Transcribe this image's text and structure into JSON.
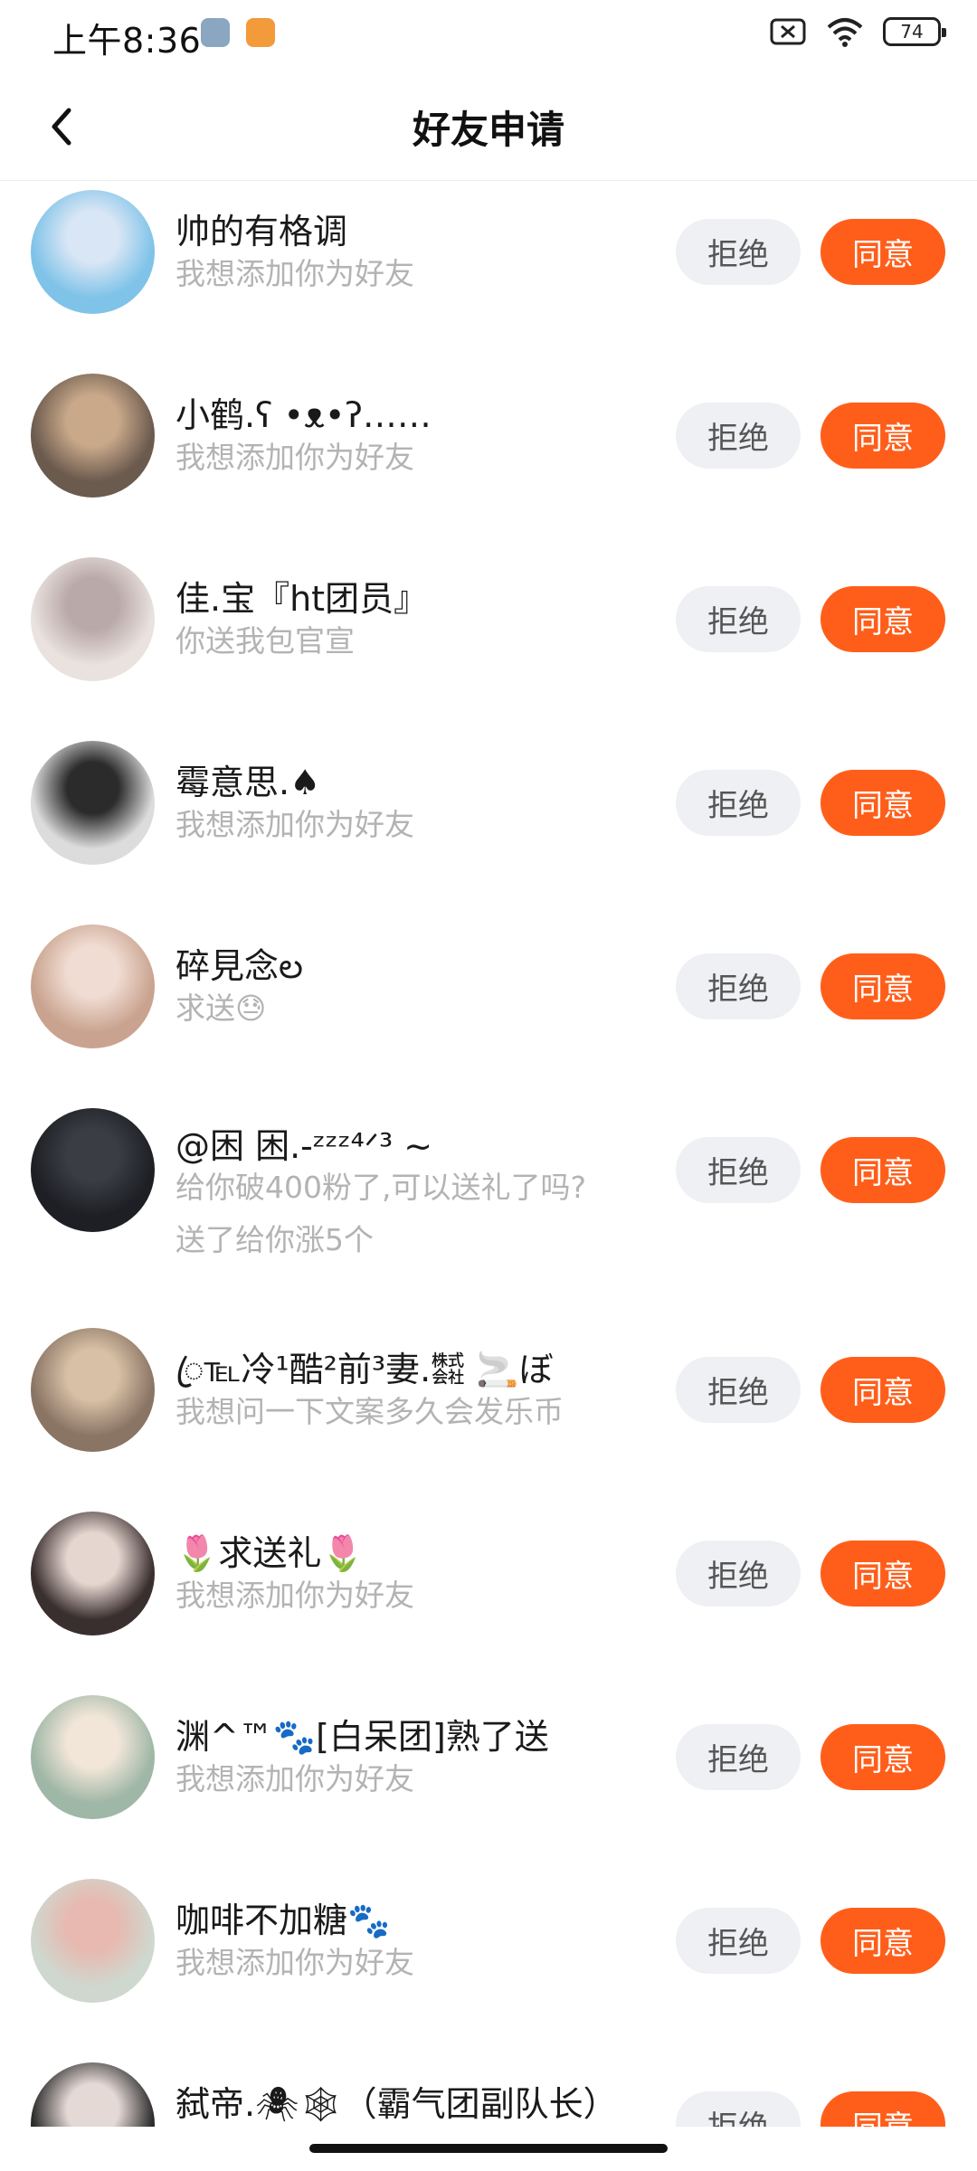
{
  "status_bar": {
    "time": "上午8:36",
    "battery": "74",
    "icons": [
      "auto-rotate-icon",
      "app-notification-icon",
      "no-sim-icon",
      "wifi-icon",
      "battery-icon"
    ]
  },
  "header": {
    "title": "好友申请",
    "back_icon": "chevron-left-icon"
  },
  "buttons": {
    "reject_label": "拒绝",
    "accept_label": "同意"
  },
  "requests": [
    {
      "name": "帅的有格调",
      "message": "我想添加你为好友",
      "avatar_colors": [
        "#7fc3e8",
        "#d9e6f5"
      ]
    },
    {
      "name": "小鹤.ʕ •ᴥ•ʔ……",
      "message": "我想添加你为好友",
      "avatar_colors": [
        "#6b5a4e",
        "#c9a98a"
      ]
    },
    {
      "name": "佳.宝『ht团员』",
      "message": "你送我包官宣",
      "avatar_colors": [
        "#e9e2df",
        "#b9a9a8"
      ]
    },
    {
      "name": "霉意思.♠",
      "message": "我想添加你为好友",
      "avatar_colors": [
        "#dcdcdc",
        "#2b2b2b"
      ]
    },
    {
      "name": "碎見念ల",
      "message": "求送😓",
      "avatar_colors": [
        "#c9a38f",
        "#f0dcd2"
      ]
    },
    {
      "name": "@困 困.-ᶻᶻᶻ⁴ᐟ³ ~",
      "message": "给你破400粉了,可以送礼了吗?",
      "message2": "送了给你涨5个",
      "avatar_colors": [
        "#1d1f24",
        "#3a3d44"
      ]
    },
    {
      "name": "ꦿ℡冷¹酷²前³妻.㍿ 🚬ぼ",
      "message": "我想问一下文案多久会发乐币",
      "avatar_colors": [
        "#8a7464",
        "#d8c0a6"
      ]
    },
    {
      "name": "🌷求送礼🌷",
      "message": "我想添加你为好友",
      "avatar_colors": [
        "#3a2f2f",
        "#e6d6d0"
      ]
    },
    {
      "name": "渊^™🐾[白呆团]熟了送",
      "message": "我想添加你为好友",
      "avatar_colors": [
        "#9fb7a6",
        "#f2e6d9"
      ]
    },
    {
      "name": "咖啡不加糖🐾",
      "message": "我想添加你为好友",
      "avatar_colors": [
        "#cfd8cf",
        "#e7b9b0"
      ]
    },
    {
      "name": "弑帝.🕷🕸（霸气团副队长）",
      "message": "",
      "avatar_colors": [
        "#2b2b2b",
        "#e5d9d6"
      ]
    }
  ]
}
